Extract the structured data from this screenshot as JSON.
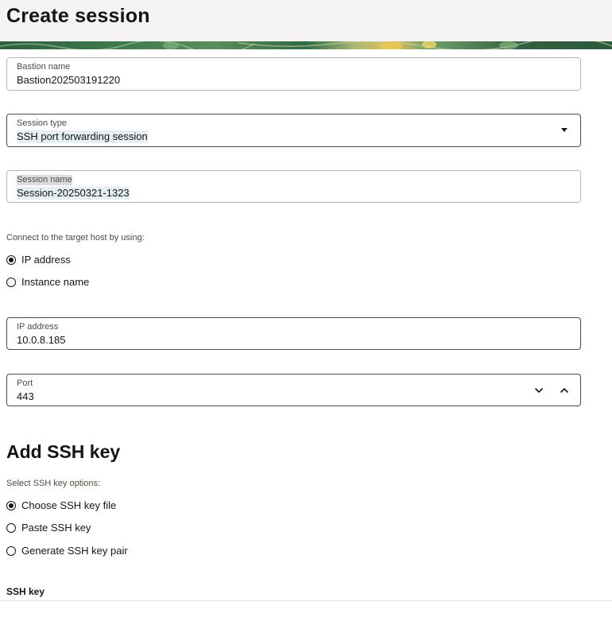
{
  "header": {
    "title": "Create session"
  },
  "form": {
    "bastion_name": {
      "label": "Bastion name",
      "value": "Bastion202503191220"
    },
    "session_type": {
      "label": "Session type",
      "value": "SSH port forwarding session"
    },
    "session_name": {
      "label": "Session name",
      "value": "Session-20250321-1323"
    },
    "connect": {
      "label": "Connect to the target host by using:",
      "options": [
        {
          "label": "IP address",
          "checked": true
        },
        {
          "label": "Instance name",
          "checked": false
        }
      ]
    },
    "ip_address": {
      "label": "IP address",
      "value": "10.0.8.185"
    },
    "port": {
      "label": "Port",
      "value": "443"
    }
  },
  "ssh": {
    "heading": "Add SSH key",
    "options_label": "Select SSH key options:",
    "options": [
      {
        "label": "Choose SSH key file",
        "checked": true
      },
      {
        "label": "Paste SSH key",
        "checked": false
      },
      {
        "label": "Generate SSH key pair",
        "checked": false
      }
    ],
    "key_label": "SSH key"
  },
  "icons": {
    "select_caret": "caret-down-icon",
    "port_decrement": "chevron-down-icon",
    "port_increment": "chevron-up-icon"
  }
}
